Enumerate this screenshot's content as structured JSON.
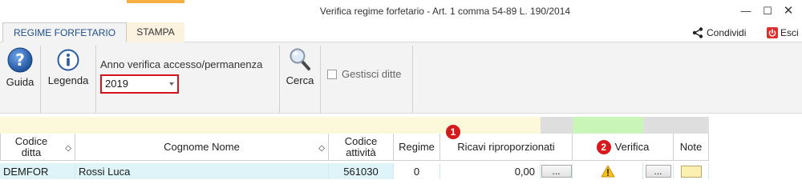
{
  "window": {
    "title": "Verifica regime forfetario - Art. 1 comma 54-89 L. 190/2014",
    "minimize": "—",
    "maximize": "☐",
    "close": "✕"
  },
  "tabs": {
    "active": "REGIME FORFETARIO",
    "stampa": "STAMPA"
  },
  "actions": {
    "condividi": "Condividi",
    "esci": "Esci"
  },
  "ribbon": {
    "guida": "Guida",
    "legenda": "Legenda",
    "anno_label": "Anno verifica accesso/permanenza",
    "anno_value": "2019",
    "cerca": "Cerca",
    "gestisci_ditte": "Gestisci ditte",
    "gestisci_checked": false
  },
  "grid": {
    "headers": {
      "codice_ditta": "Codice ditta",
      "cognome_nome": "Cognome Nome",
      "codice_attivita": "Codice attività",
      "regime": "Regime",
      "ricavi": "Ricavi riproporzionati",
      "verifica": "Verifica",
      "note": "Note"
    },
    "badges": {
      "ricavi": "1",
      "verifica": "2"
    },
    "sort_symbol": "◇",
    "rows": [
      {
        "codice_ditta": "DEMFOR",
        "cognome_nome": "Rossi Luca",
        "codice_attivita": "561030",
        "regime": "0",
        "ricavi": "0,00",
        "button": "...",
        "verifica_button": "..."
      }
    ]
  },
  "colors": {
    "accent_tab": "#f5b041",
    "band_yellow": "#fbf9d9",
    "band_gray": "#dedede",
    "band_green": "#c9f5b8",
    "row_cyan": "#dff4f8",
    "highlight_red": "#d4141c"
  }
}
